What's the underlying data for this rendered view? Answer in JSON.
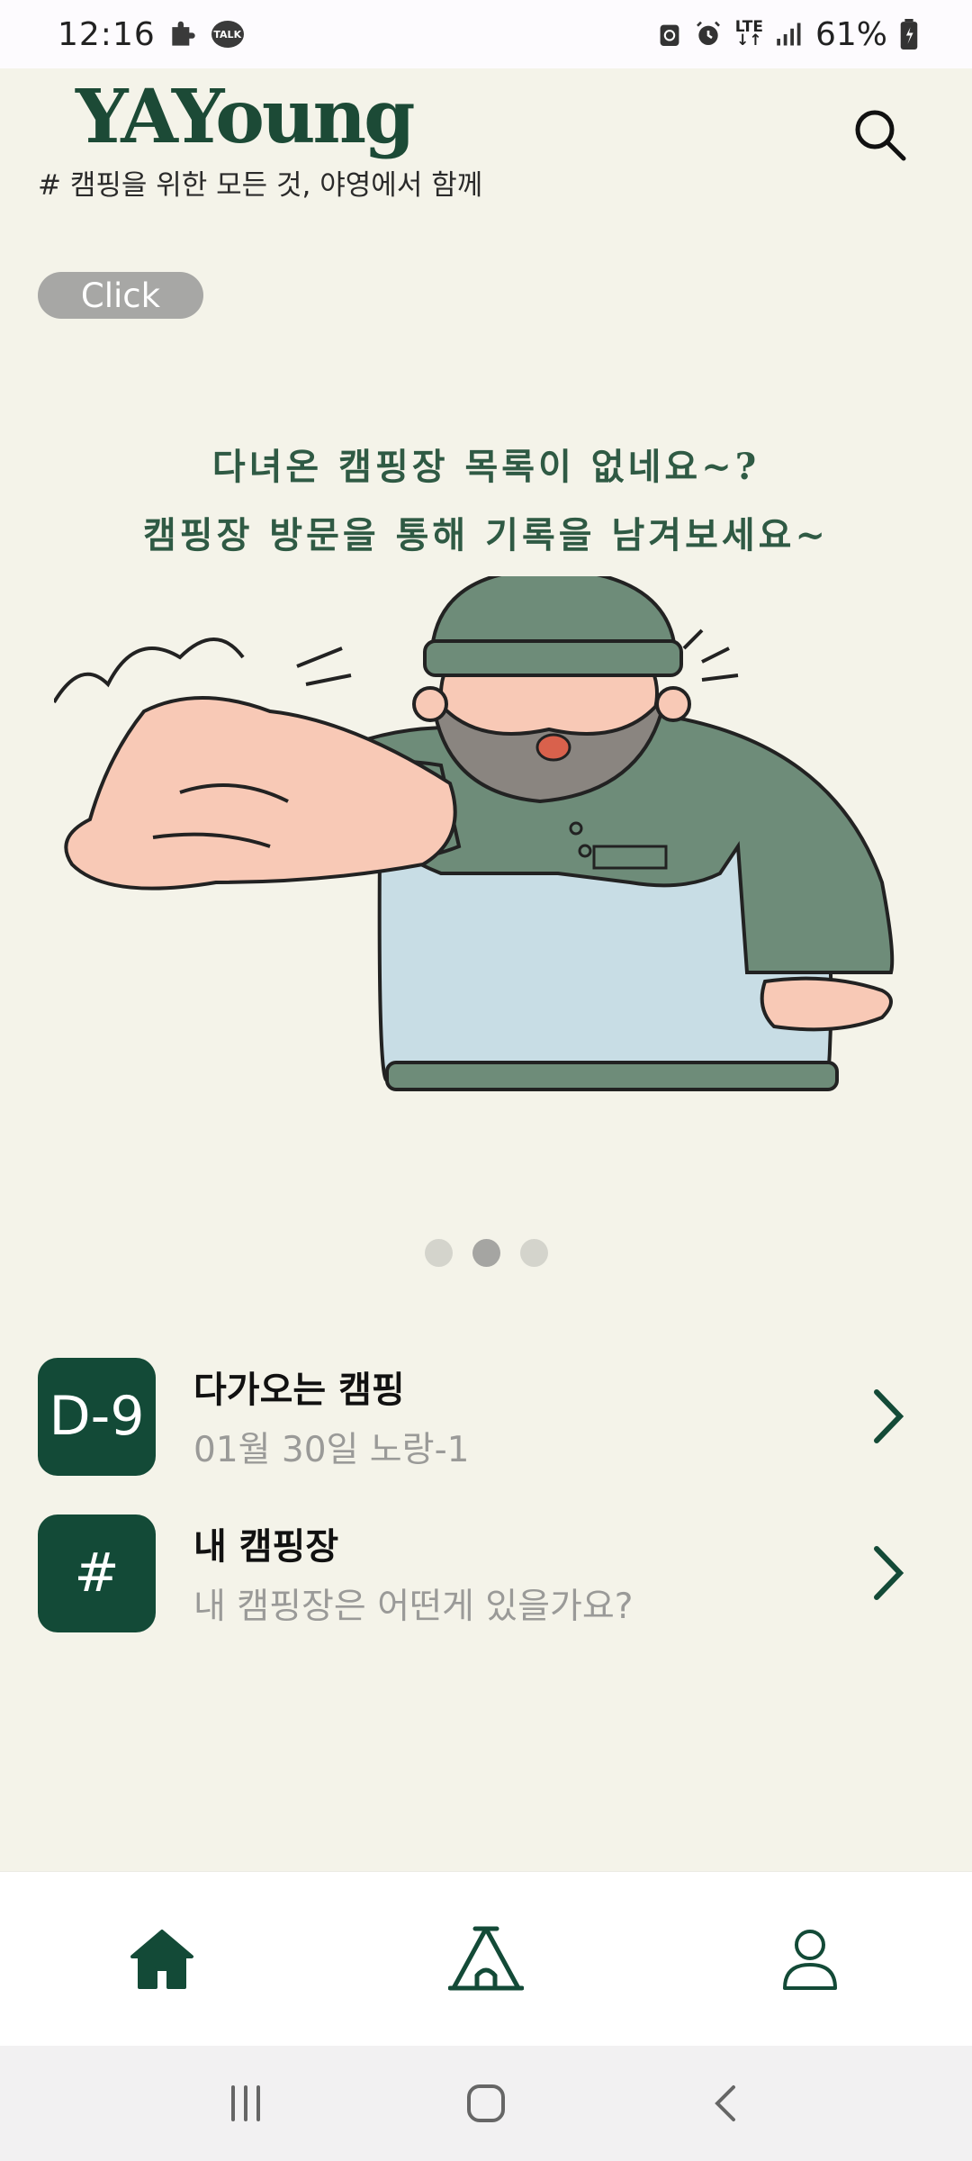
{
  "status_bar": {
    "time": "12:16",
    "talk_label": "TALK",
    "network": "LTE",
    "battery": "61%"
  },
  "header": {
    "logo": "YAYoung",
    "tagline": "# 캠핑을 위한 모든 것, 야영에서 함께"
  },
  "click_button": "Click",
  "banner": {
    "line1": "다녀온 캠핑장 목록이 없네요~?",
    "line2": "캠핑장 방문을 통해 기록을 남겨보세요~",
    "pages": 3,
    "active_page": 2
  },
  "list": [
    {
      "badge": "D-9",
      "title": "다가오는 캠핑",
      "subtitle": "01월 30일 노랑-1"
    },
    {
      "badge": "#",
      "title": "내 캠핑장",
      "subtitle": "내 캠핑장은 어떤게 있을가요?"
    }
  ],
  "icons": {
    "search": "search-icon",
    "nav_home": "home-icon",
    "nav_camp": "tent-icon",
    "nav_profile": "profile-icon",
    "chevron": "chevron-right-icon"
  },
  "colors": {
    "brand": "#134a37",
    "background": "#f4f3e9",
    "pill": "#a7a7a5",
    "subtext": "#9a9a98"
  }
}
